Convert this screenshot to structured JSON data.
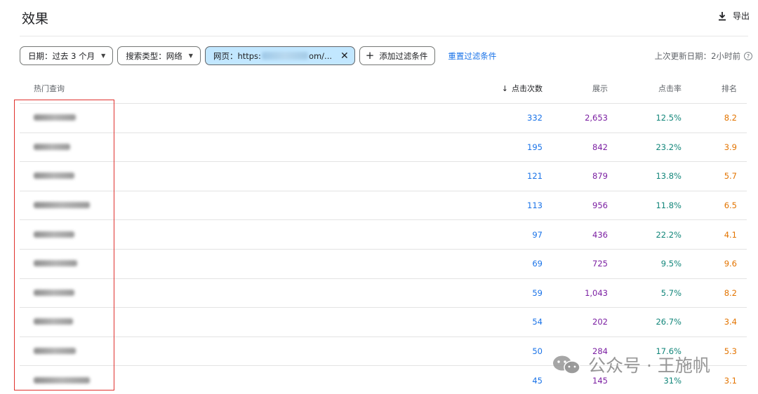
{
  "header": {
    "title": "效果",
    "export_label": "导出"
  },
  "filters": {
    "date": "日期：过去 3 个月",
    "search_type": "搜索类型：网络",
    "page_prefix": "网页：https:",
    "page_suffix": "om/...",
    "add": "添加过滤条件",
    "reset": "重置过滤条件"
  },
  "updated": "上次更新日期：2小时前",
  "table": {
    "columns": {
      "query": "热门查询",
      "clicks": "点击次数",
      "impressions": "展示",
      "ctr": "点击率",
      "position": "排名"
    },
    "rows": [
      {
        "clicks": "332",
        "impressions": "2,653",
        "ctr": "12.5%",
        "position": "8.2"
      },
      {
        "clicks": "195",
        "impressions": "842",
        "ctr": "23.2%",
        "position": "3.9"
      },
      {
        "clicks": "121",
        "impressions": "879",
        "ctr": "13.8%",
        "position": "5.7"
      },
      {
        "clicks": "113",
        "impressions": "956",
        "ctr": "11.8%",
        "position": "6.5"
      },
      {
        "clicks": "97",
        "impressions": "436",
        "ctr": "22.2%",
        "position": "4.1"
      },
      {
        "clicks": "69",
        "impressions": "725",
        "ctr": "9.5%",
        "position": "9.6"
      },
      {
        "clicks": "59",
        "impressions": "1,043",
        "ctr": "5.7%",
        "position": "8.2"
      },
      {
        "clicks": "54",
        "impressions": "202",
        "ctr": "26.7%",
        "position": "3.4"
      },
      {
        "clicks": "50",
        "impressions": "284",
        "ctr": "17.6%",
        "position": "5.3"
      },
      {
        "clicks": "45",
        "impressions": "145",
        "ctr": "31%",
        "position": "3.1"
      }
    ]
  },
  "watermark": "公众号 · 王施帆",
  "colors": {
    "clicks": "#1a73e8",
    "impressions": "#7b1fa2",
    "ctr": "#12867a",
    "position": "#e37400",
    "highlight_box": "#e0312d"
  }
}
